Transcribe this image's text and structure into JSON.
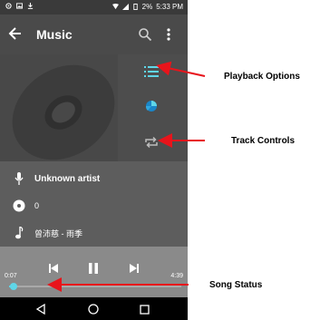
{
  "status_bar": {
    "battery": "2%",
    "time": "5:33 PM",
    "icons": [
      "notification-icon",
      "image-icon",
      "download-icon",
      "wifi-icon",
      "signal-icon",
      "battery-icon"
    ]
  },
  "app_bar": {
    "title": "Music",
    "icons": [
      "back-arrow-icon",
      "search-icon",
      "more-vert-icon"
    ]
  },
  "side_buttons": [
    "playlist-icon",
    "equalizer-icon",
    "repeat-icon"
  ],
  "track_info": {
    "artist": "Unknown artist",
    "album": "0",
    "title": "曾沛慈 - 雨季"
  },
  "player": {
    "elapsed": "0:07",
    "duration": "4:39",
    "progress_fraction": 0.025,
    "buttons": [
      "previous-icon",
      "pause-icon",
      "next-icon"
    ]
  },
  "nav_bar": [
    "back-triangle-icon",
    "home-circle-icon",
    "recents-square-icon"
  ],
  "callouts": {
    "playback_options": "Playback Options",
    "track_controls": "Track Controls",
    "song_status": "Song Status"
  },
  "colors": {
    "accent": "#5fd6e8",
    "annotation_arrow": "#e8141b"
  }
}
